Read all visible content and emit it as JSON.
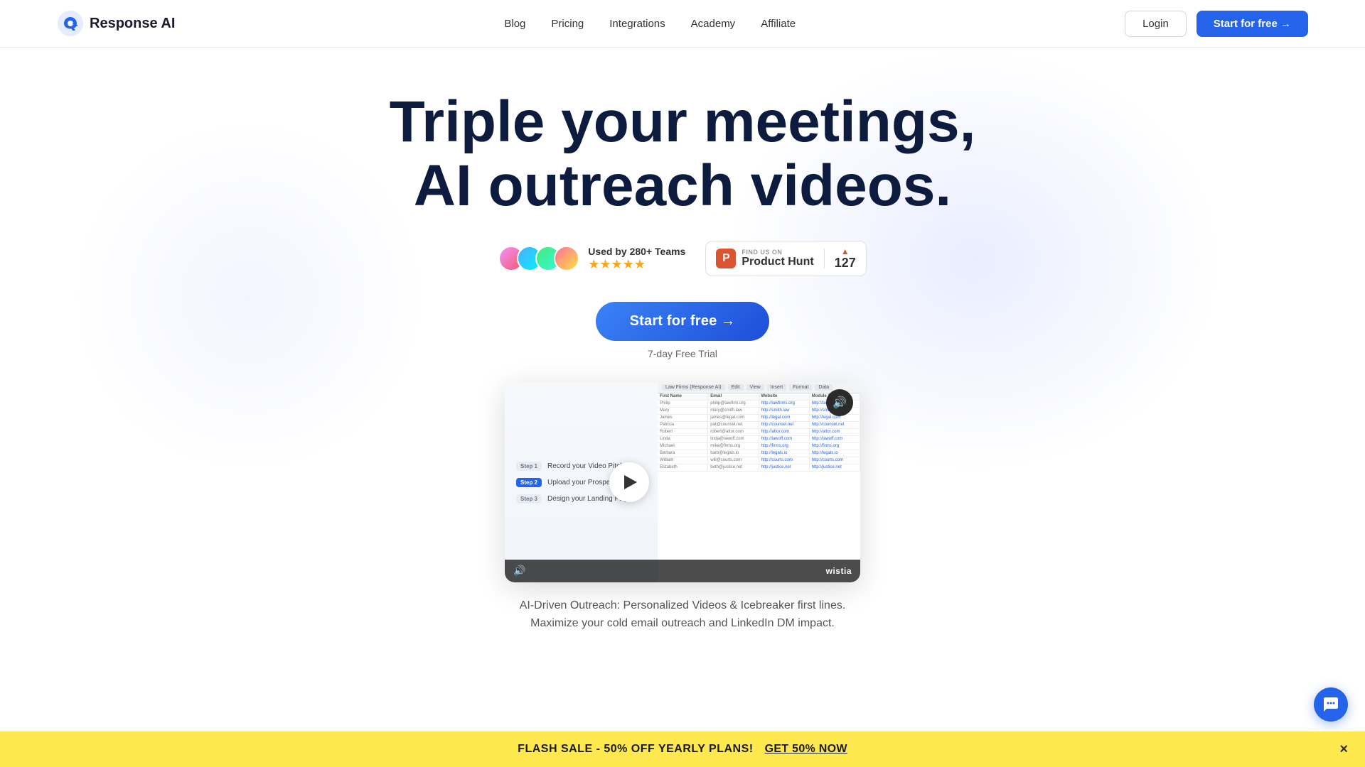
{
  "brand": {
    "name": "Response AI",
    "logo_letter": "Q"
  },
  "navbar": {
    "links": [
      {
        "label": "Blog",
        "href": "#"
      },
      {
        "label": "Pricing",
        "href": "#"
      },
      {
        "label": "Integrations",
        "href": "#"
      },
      {
        "label": "Academy",
        "href": "#"
      },
      {
        "label": "Affiliate",
        "href": "#"
      }
    ],
    "login_label": "Login",
    "start_label": "Start for free →"
  },
  "hero": {
    "title_line1": "Triple your meetings,",
    "title_line2": "AI outreach videos.",
    "badge_teams_label": "Used by 280+ Teams",
    "stars": "★★★★★",
    "producthunt": {
      "find_text": "FIND US ON",
      "name": "Product Hunt",
      "count": "127",
      "logo_letter": "P"
    },
    "cta_button": "Start for free →",
    "trial_text": "7-day Free Trial",
    "subtitle_line1": "AI-Driven Outreach: Personalized Videos & Icebreaker first lines.",
    "subtitle_line2": "Maximize your cold email outreach and LinkedIn DM impact."
  },
  "video": {
    "steps": [
      {
        "badge": "Step 1",
        "text": "Record your Video Pitch",
        "active": false
      },
      {
        "badge": "Step 2",
        "text": "Upload your Prospect List",
        "active": true
      },
      {
        "badge": "Step 3",
        "text": "Design your Landing Page",
        "active": false
      }
    ],
    "spreadsheet": {
      "tab_label": "Law Firms (Response AI)",
      "headers": [
        "First Name",
        "Email",
        "Website",
        "Module 2 Draft"
      ],
      "rows": [
        [
          "Philip",
          "philip@lawfirm.org",
          "http://lawfirms.org",
          "http://lawfirms.org"
        ],
        [
          "Mary",
          "mary@smith.law",
          "http://smith.law",
          "http://smith.law"
        ],
        [
          "James",
          "james@legal.com",
          "http://legal.com",
          "http://legal.com"
        ],
        [
          "Patricia",
          "pat@counsel.net",
          "http://counsel.net",
          "http://counsel.net"
        ],
        [
          "Robert",
          "robert@attor.com",
          "http://attor.com",
          "http://attor.com"
        ],
        [
          "Linda",
          "linda@lawoff.com",
          "http://lawoff.com",
          "http://lawoff.com"
        ],
        [
          "Michael",
          "mike@firms.org",
          "http://firms.org",
          "http://firms.org"
        ],
        [
          "Barbara",
          "barb@legals.io",
          "http://legals.io",
          "http://legals.io"
        ],
        [
          "William",
          "will@courts.com",
          "http://courts.com",
          "http://courts.com"
        ],
        [
          "Elizabeth",
          "beth@justice.net",
          "http://justice.net",
          "http://justice.net"
        ]
      ]
    },
    "wistia_label": "wistia"
  },
  "flash_banner": {
    "text": "FLASH SALE - 50% OFF YEARLY PLANS!",
    "cta_label": "GET 50% NOW",
    "close_label": "×"
  }
}
